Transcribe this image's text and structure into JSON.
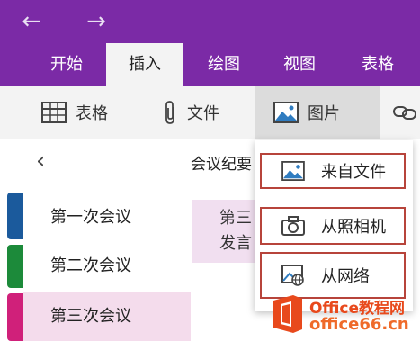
{
  "titlebar": {
    "back_icon": "arrow-left-icon",
    "forward_icon": "arrow-right-icon",
    "tabs": [
      "开始",
      "插入",
      "绘图",
      "视图",
      "表格"
    ],
    "active_tab": "插入",
    "color": "#7b2aa6"
  },
  "ribbon": {
    "items": [
      {
        "label": "表格",
        "icon": "table-icon"
      },
      {
        "label": "文件",
        "icon": "paperclip-icon"
      },
      {
        "label": "图片",
        "icon": "picture-icon"
      },
      {
        "label": "",
        "icon": "link-icon"
      }
    ]
  },
  "notebook": {
    "section_colors": [
      "#1b5a9c",
      "#1c8a3a",
      "#d0207a"
    ],
    "back_icon": "chevron-left-icon",
    "page_title": "会议纪要",
    "pages": [
      "第一次会议",
      "第二次会议",
      "第三次会议"
    ],
    "selected_page": "第三次会议"
  },
  "content": {
    "lines": [
      "第三",
      "发言"
    ]
  },
  "picture_menu": {
    "items": [
      {
        "label": "来自文件",
        "icon": "picture-icon"
      },
      {
        "label": "从照相机",
        "icon": "camera-icon"
      },
      {
        "label": "从网络",
        "icon": "web-image-icon"
      }
    ],
    "highlight_color": "#b7443b"
  },
  "watermark": {
    "line1": "Office教程网",
    "line2": "office66.cn"
  }
}
